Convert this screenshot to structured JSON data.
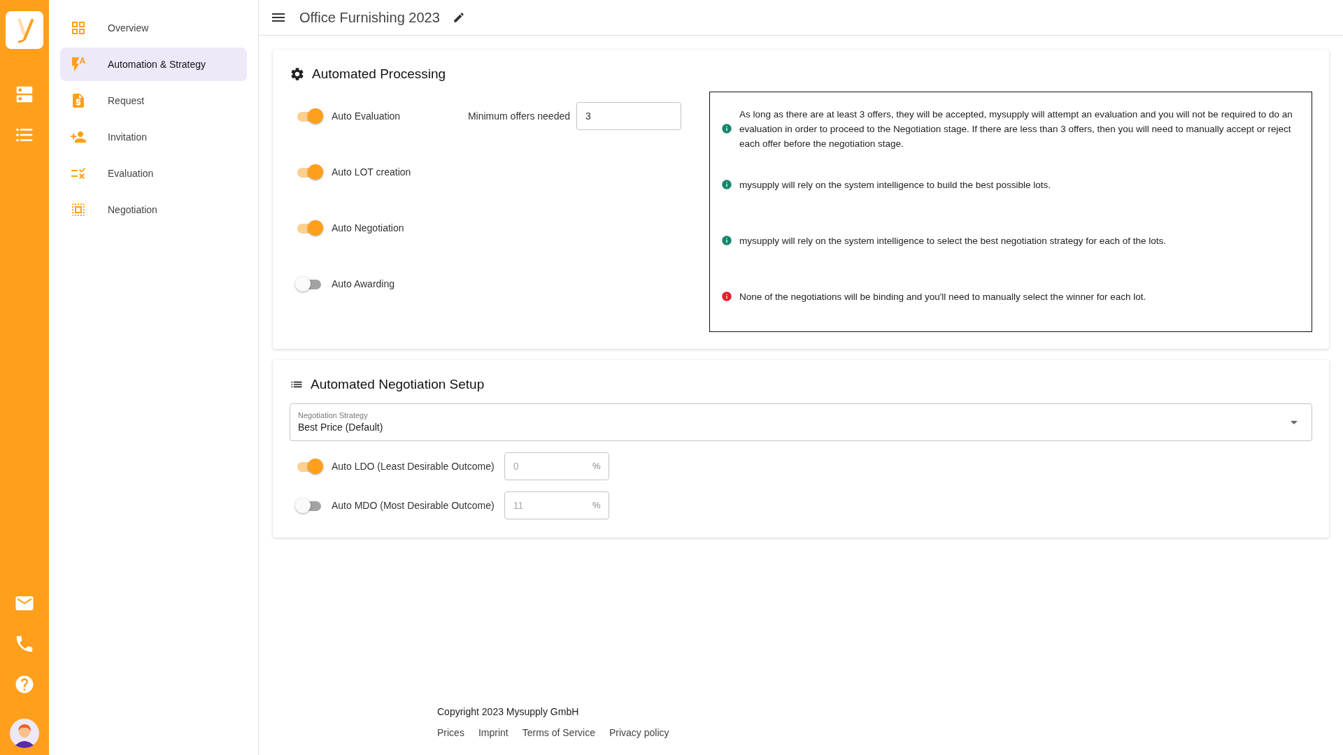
{
  "rail": {
    "top_items": [
      {
        "kind": "servers"
      },
      {
        "kind": "list"
      }
    ],
    "bottom_items": [
      {
        "kind": "mail"
      },
      {
        "kind": "phone"
      },
      {
        "kind": "help"
      }
    ]
  },
  "nav": [
    {
      "label": "Overview",
      "kind": "overview",
      "selected": false
    },
    {
      "label": "Automation & Strategy",
      "kind": "automation",
      "selected": true
    },
    {
      "label": "Request",
      "kind": "request",
      "selected": false
    },
    {
      "label": "Invitation",
      "kind": "invitation",
      "selected": false
    },
    {
      "label": "Evaluation",
      "kind": "evaluation",
      "selected": false
    },
    {
      "label": "Negotiation",
      "kind": "negotiation",
      "selected": false
    }
  ],
  "header": {
    "title": "Office Furnishing 2023"
  },
  "automated_processing": {
    "title": "Automated Processing",
    "toggles": [
      {
        "label": "Auto Evaluation",
        "on": true,
        "field": {
          "label": "Minimum offers needed",
          "value": "3"
        }
      },
      {
        "label": "Auto LOT creation",
        "on": true
      },
      {
        "label": "Auto Negotiation",
        "on": true
      },
      {
        "label": "Auto Awarding",
        "on": false
      }
    ],
    "notes": [
      {
        "kind": "info",
        "text": "As long as there are at least 3 offers, they will be accepted, mysupply will attempt an evaluation and you will not be required to do an evaluation in order to proceed to the Negotiation stage. If there are less than 3 offers, then you will need to manually accept or reject each offer before the negotiation stage."
      },
      {
        "kind": "info",
        "text": "mysupply will rely on the system intelligence to build the best possible lots."
      },
      {
        "kind": "info",
        "text": "mysupply will rely on the system intelligence to select the best negotiation strategy for each of the lots."
      },
      {
        "kind": "warning",
        "text": "None of the negotiations will be binding and you'll need to manually select the winner for each lot."
      }
    ]
  },
  "negotiation_setup": {
    "title": "Automated Negotiation Setup",
    "strategy": {
      "label": "Negotiation Strategy",
      "value": "Best Price (Default)"
    },
    "toggles": [
      {
        "label": "Auto LDO (Least Desirable Outcome)",
        "on": true,
        "placeholder": "0",
        "unit": "%"
      },
      {
        "label": "Auto MDO (Most Desirable Outcome)",
        "on": false,
        "placeholder": "11",
        "unit": "%"
      }
    ]
  },
  "footer": {
    "copyright": "Copyright 2023 Mysupply GmbH",
    "links": [
      "Prices",
      "Imprint",
      "Terms of Service",
      "Privacy policy"
    ]
  }
}
